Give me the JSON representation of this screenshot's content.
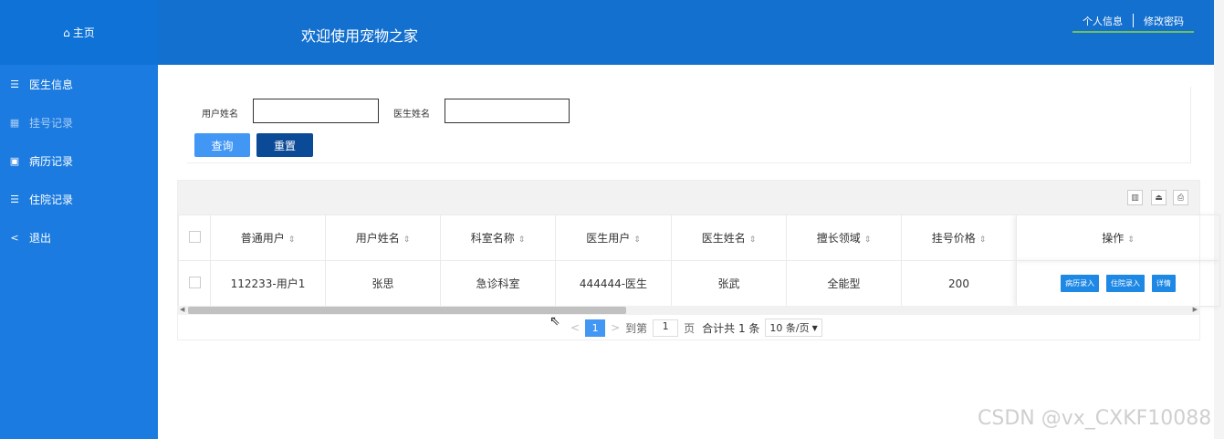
{
  "sidebar": {
    "home_label": "主页",
    "items": [
      {
        "label": "医生信息",
        "icon": "list-icon"
      },
      {
        "label": "挂号记录",
        "icon": "grid-icon"
      },
      {
        "label": "病历记录",
        "icon": "book-icon"
      },
      {
        "label": "住院记录",
        "icon": "list-icon"
      },
      {
        "label": "退出",
        "icon": "share-icon"
      }
    ]
  },
  "header": {
    "title": "欢迎使用宠物之家",
    "links": [
      "个人信息",
      "修改密码"
    ]
  },
  "search": {
    "user_name_label": "用户姓名",
    "doctor_name_label": "医生姓名",
    "user_name_value": "",
    "doctor_name_value": "",
    "query_button": "查询",
    "reset_button": "重置"
  },
  "table": {
    "columns": [
      "普通用户",
      "用户姓名",
      "科室名称",
      "医生用户",
      "医生姓名",
      "擅长领域",
      "挂号价格",
      "操作"
    ],
    "rows": [
      {
        "cells": [
          "112233-用户1",
          "张思",
          "急诊科室",
          "444444-医生",
          "张武",
          "全能型",
          "200"
        ],
        "actions": [
          "病历录入",
          "住院录入",
          "详情"
        ]
      }
    ]
  },
  "pager": {
    "prev": "<",
    "current_page": "1",
    "next": ">",
    "goto_label": "到第",
    "goto_value": "1",
    "page_unit": "页",
    "total": "合计共 1 条",
    "page_size": "10 条/页"
  },
  "watermark": "CSDN @vx_CXKF10088"
}
